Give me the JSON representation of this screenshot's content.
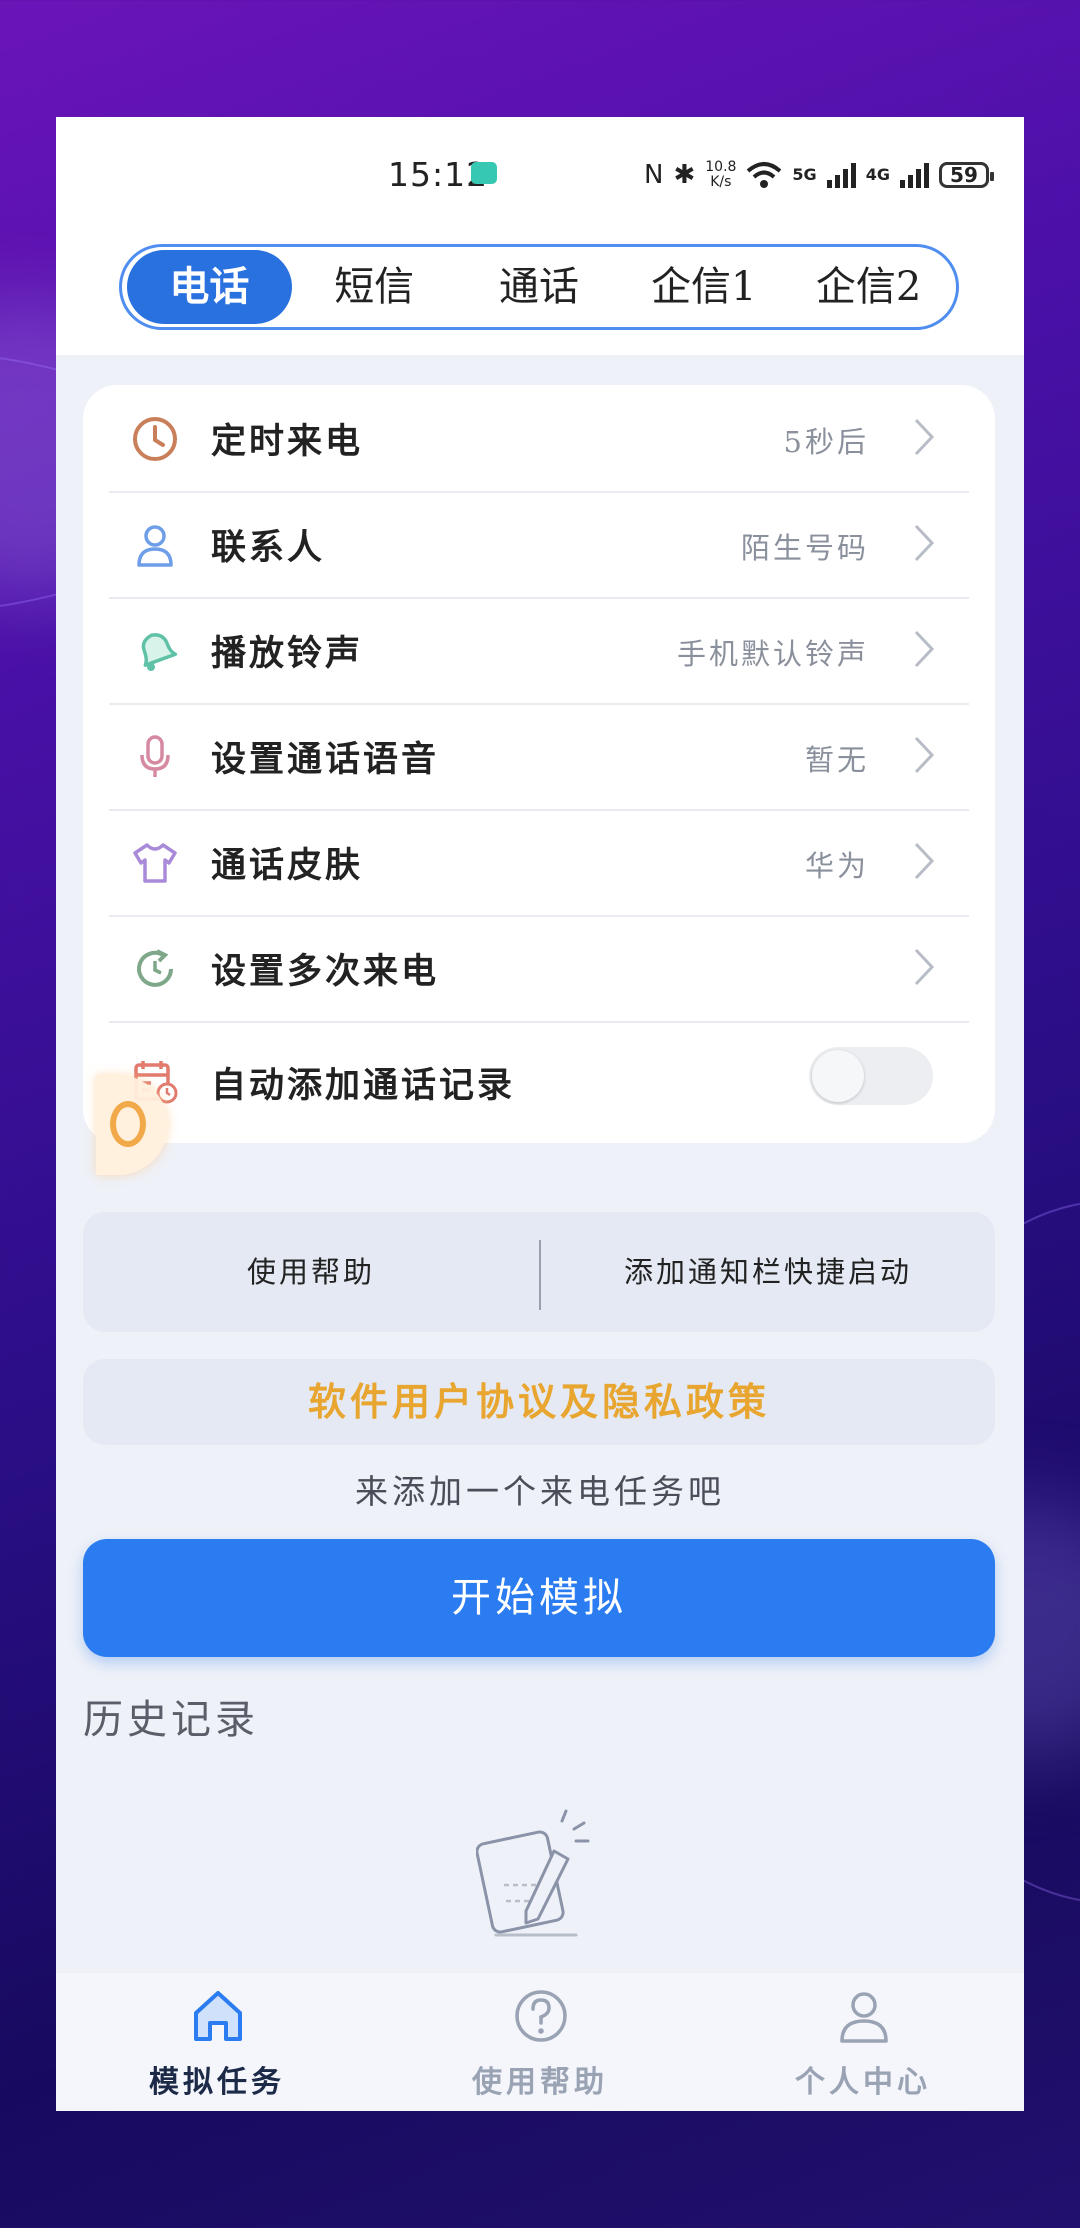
{
  "status": {
    "time": "15:12",
    "speed_value": "10.8",
    "speed_unit": "K/s",
    "net1": "5G",
    "net2": "4G",
    "battery": "59"
  },
  "tabs": [
    {
      "label": "电话",
      "active": true
    },
    {
      "label": "短信"
    },
    {
      "label": "通话"
    },
    {
      "label": "企信1"
    },
    {
      "label": "企信2"
    }
  ],
  "settings": [
    {
      "icon": "clock-icon",
      "label": "定时来电",
      "value": "5秒后",
      "color": "#c9805a"
    },
    {
      "icon": "person-icon",
      "label": "联系人",
      "value": "陌生号码",
      "color": "#6e9ee8"
    },
    {
      "icon": "bell-icon",
      "label": "播放铃声",
      "value": "手机默认铃声",
      "color": "#5fc2a6"
    },
    {
      "icon": "microphone-icon",
      "label": "设置通话语音",
      "value": "暂无",
      "color": "#d68aa1"
    },
    {
      "icon": "shirt-icon",
      "label": "通话皮肤",
      "value": "华为",
      "color": "#a98ad8"
    },
    {
      "icon": "repeat-icon",
      "label": "设置多次来电",
      "value": "",
      "color": "#7fa78a"
    },
    {
      "icon": "calendar-icon",
      "label": "自动添加通话记录",
      "toggle": false,
      "color": "#e27a6e"
    }
  ],
  "help_bar": {
    "left": "使用帮助",
    "right": "添加通知栏快捷启动"
  },
  "agreement": "软件用户协议及隐私政策",
  "hint": "来添加一个来电任务吧",
  "start_button": "开始模拟",
  "history_title": "历史记录",
  "bottom_nav": [
    {
      "label": "模拟任务",
      "icon": "home-icon",
      "active": true
    },
    {
      "label": "使用帮助",
      "icon": "help-icon"
    },
    {
      "label": "个人中心",
      "icon": "user-icon"
    }
  ]
}
